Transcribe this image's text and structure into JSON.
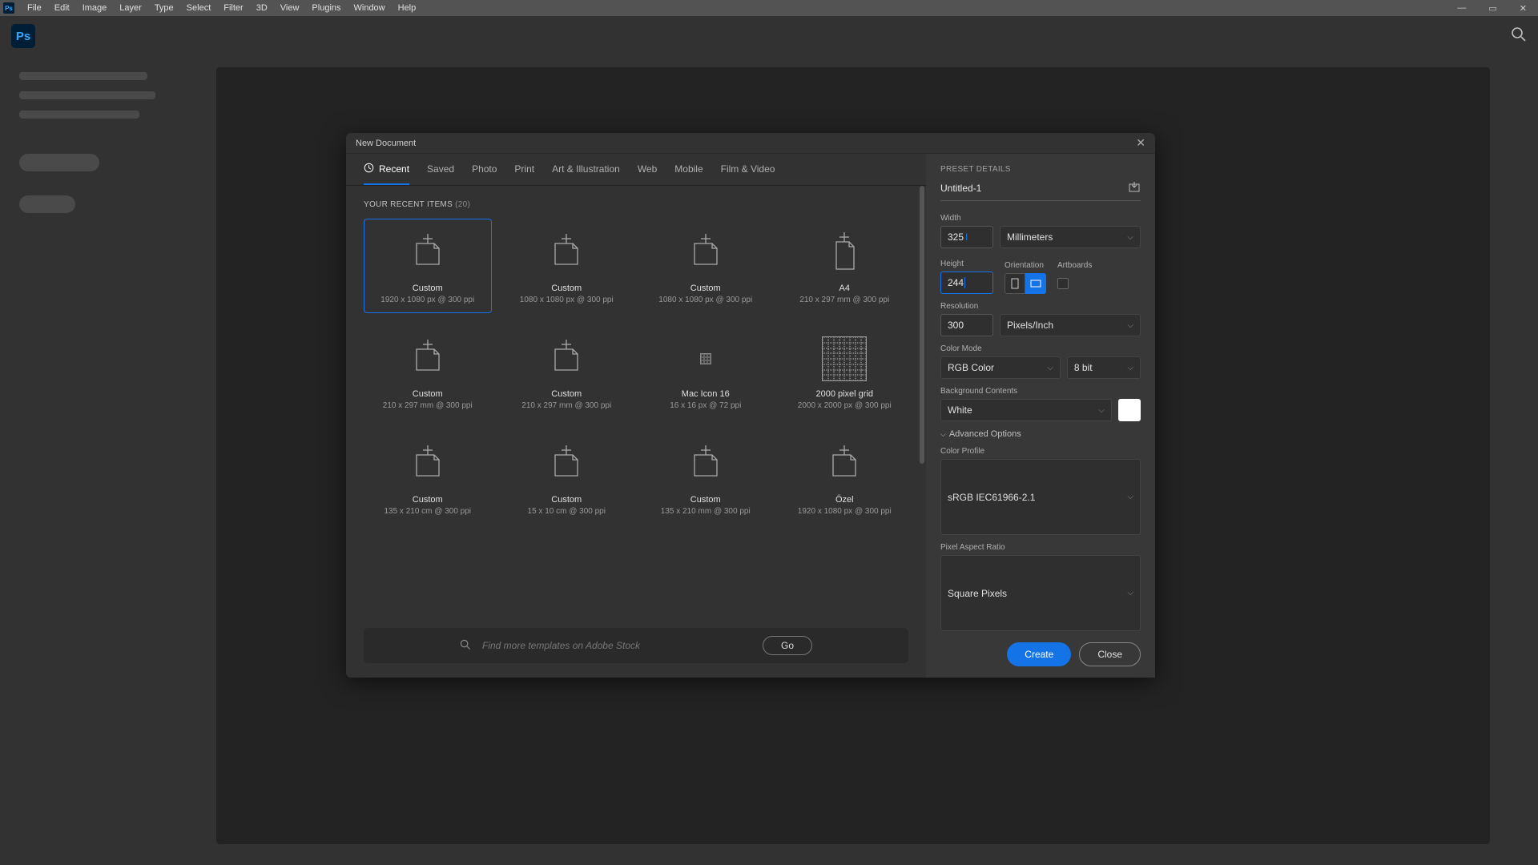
{
  "menubar": [
    "File",
    "Edit",
    "Image",
    "Layer",
    "Type",
    "Select",
    "Filter",
    "3D",
    "View",
    "Plugins",
    "Window",
    "Help"
  ],
  "dialog": {
    "title": "New Document",
    "tabs": [
      "Recent",
      "Saved",
      "Photo",
      "Print",
      "Art & Illustration",
      "Web",
      "Mobile",
      "Film & Video"
    ],
    "active_tab": 0,
    "section_label": "YOUR RECENT ITEMS",
    "count": "(20)",
    "presets": [
      {
        "name": "Custom",
        "dims": "1920 x 1080 px @ 300 ppi",
        "kind": "doc",
        "selected": true
      },
      {
        "name": "Custom",
        "dims": "1080 x 1080 px @ 300 ppi",
        "kind": "doc"
      },
      {
        "name": "Custom",
        "dims": "1080 x 1080 px @ 300 ppi",
        "kind": "doc"
      },
      {
        "name": "A4",
        "dims": "210 x 297 mm @ 300 ppi",
        "kind": "doc-portrait"
      },
      {
        "name": "Custom",
        "dims": "210 x 297 mm @ 300 ppi",
        "kind": "doc"
      },
      {
        "name": "Custom",
        "dims": "210 x 297 mm @ 300 ppi",
        "kind": "doc"
      },
      {
        "name": "Mac Icon 16",
        "dims": "16 x 16 px @ 72 ppi",
        "kind": "tiny"
      },
      {
        "name": "2000 pixel grid",
        "dims": "2000 x 2000 px @ 300 ppi",
        "kind": "grid"
      },
      {
        "name": "Custom",
        "dims": "135 x 210 cm @ 300 ppi",
        "kind": "doc"
      },
      {
        "name": "Custom",
        "dims": "15 x 10 cm @ 300 ppi",
        "kind": "doc"
      },
      {
        "name": "Custom",
        "dims": "135 x 210 mm @ 300 ppi",
        "kind": "doc"
      },
      {
        "name": "Özel",
        "dims": "1920 x 1080 px @ 300 ppi",
        "kind": "doc"
      }
    ],
    "stock": {
      "placeholder": "Find more templates on Adobe Stock",
      "go": "Go"
    }
  },
  "details": {
    "title": "PRESET DETAILS",
    "name": "Untitled-1",
    "width_label": "Width",
    "width": "325",
    "units": "Millimeters",
    "height_label": "Height",
    "height": "244",
    "orientation_label": "Orientation",
    "artboards_label": "Artboards",
    "resolution_label": "Resolution",
    "resolution": "300",
    "res_units": "Pixels/Inch",
    "colormode_label": "Color Mode",
    "colormode": "RGB Color",
    "depth": "8 bit",
    "bgcontents_label": "Background Contents",
    "bgcontents": "White",
    "advanced": "Advanced Options",
    "profile_label": "Color Profile",
    "profile": "sRGB IEC61966-2.1",
    "aspect_label": "Pixel Aspect Ratio",
    "aspect": "Square Pixels",
    "create": "Create",
    "close": "Close"
  }
}
